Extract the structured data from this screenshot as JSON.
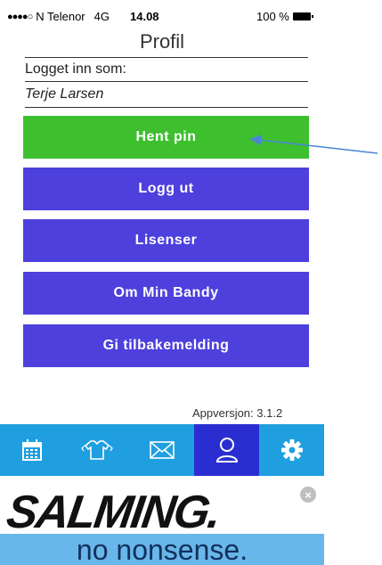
{
  "status_bar": {
    "signal_dots": "●●●●○",
    "carrier": "N Telenor",
    "network": "4G",
    "time": "14.08",
    "battery": "100 %"
  },
  "header": {
    "title": "Profil"
  },
  "profile": {
    "logged_in_label": "Logget inn som:",
    "user_name": "Terje Larsen"
  },
  "buttons": {
    "get_pin": "Hent pin",
    "logout": "Logg ut",
    "licenses": "Lisenser",
    "about": "Om Min Bandy",
    "feedback": "Gi tilbakemelding"
  },
  "app_version": "Appversjon: 3.1.2",
  "tab_bar": {
    "tabs": [
      {
        "icon": "calendar-icon"
      },
      {
        "icon": "jersey-icon"
      },
      {
        "icon": "mail-icon"
      },
      {
        "icon": "profile-icon",
        "active": true
      },
      {
        "icon": "gear-icon"
      }
    ]
  },
  "ad": {
    "brand": "SALMING.",
    "slogan": "no nonsense.",
    "close": "×"
  },
  "colors": {
    "green_button": "#3ebf2e",
    "blue_button": "#4d40dd",
    "tab_bar": "#1f9fdf",
    "tab_active": "#2a2ed0",
    "annotation_arrow": "#4a84d8"
  }
}
